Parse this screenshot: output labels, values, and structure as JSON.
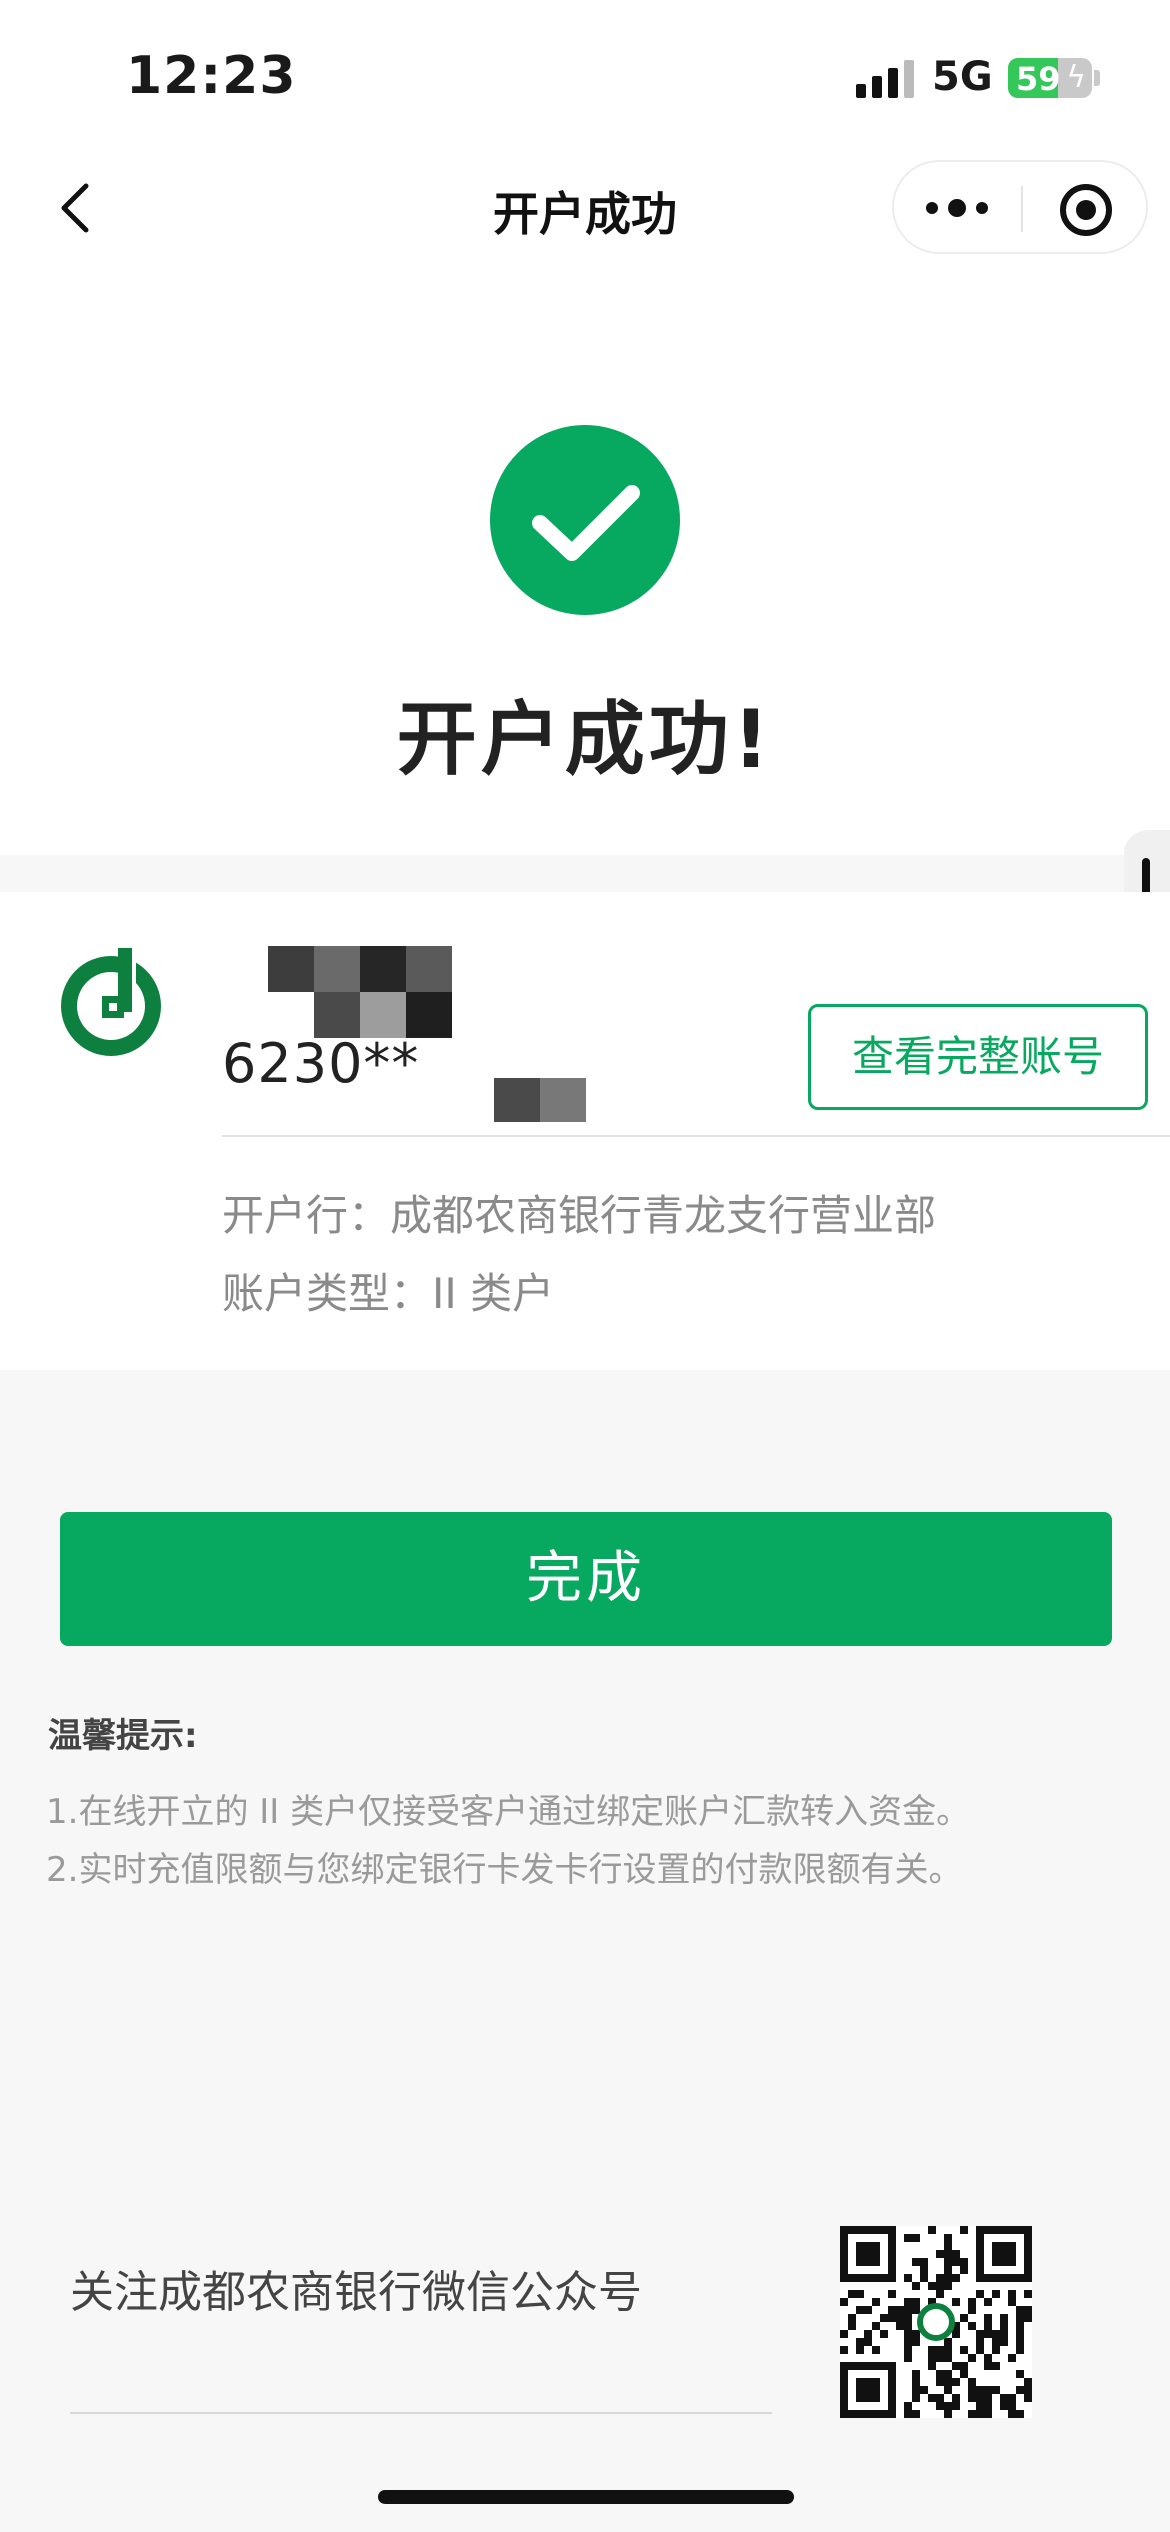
{
  "status_bar": {
    "time": "12:23",
    "network": "5G",
    "battery_level": "59",
    "battery_fraction": 0.59,
    "battery_color": "#34c759"
  },
  "nav": {
    "title": "开户成功",
    "back_icon": "chevron-left-icon",
    "more_icon": "more-dots-icon",
    "close_icon": "target-close-icon"
  },
  "success": {
    "icon": "check-circle-icon",
    "title": "开户成功!",
    "color": "#07a85f"
  },
  "account": {
    "bank_logo": "bank-logo-icon",
    "number": "6230**",
    "view_full_label": "查看完整账号",
    "branch_label": "开户行：",
    "branch_value": "成都农商银行青龙支行营业部",
    "type_label": "账户类型：",
    "type_value": "II 类户"
  },
  "actions": {
    "done_label": "完成"
  },
  "tips": {
    "title": "温馨提示:",
    "items": [
      "1.在线开立的 II 类户仅接受客户通过绑定账户汇款转入资金。",
      "2.实时充值限额与您绑定银行卡发卡行设置的付款限额有关。"
    ]
  },
  "footer": {
    "follow_label": "关注成都农商银行微信公众号",
    "qr_icon": "qr-code-icon"
  }
}
